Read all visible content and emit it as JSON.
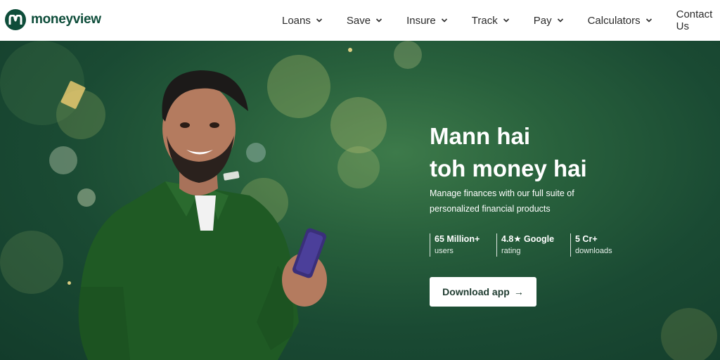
{
  "brand": {
    "name": "moneyview",
    "logo_color": "#0e4d3a"
  },
  "nav": {
    "items": [
      {
        "label": "Loans",
        "icon": "chevron-down-icon"
      },
      {
        "label": "Save",
        "icon": "chevron-down-icon"
      },
      {
        "label": "Insure",
        "icon": "chevron-down-icon"
      },
      {
        "label": "Track",
        "icon": "chevron-down-icon"
      },
      {
        "label": "Pay",
        "icon": "chevron-down-icon"
      },
      {
        "label": "Calculators",
        "icon": "chevron-down-icon"
      }
    ],
    "contact_label": "Contact Us"
  },
  "hero": {
    "title_line1": "Mann hai",
    "title_line2": "toh money hai",
    "subtitle": "Manage finances with our full suite of personalized financial products",
    "stats": [
      {
        "value": "65 Million+",
        "label": "users"
      },
      {
        "value": "4.8★ Google",
        "label": "rating"
      },
      {
        "value": "5 Cr+",
        "label": "downloads"
      }
    ],
    "cta_label": "Download app",
    "cta_icon": "arrow-right-icon",
    "background_color": "#1a4a33",
    "shirt_color": "#1f5a24"
  }
}
